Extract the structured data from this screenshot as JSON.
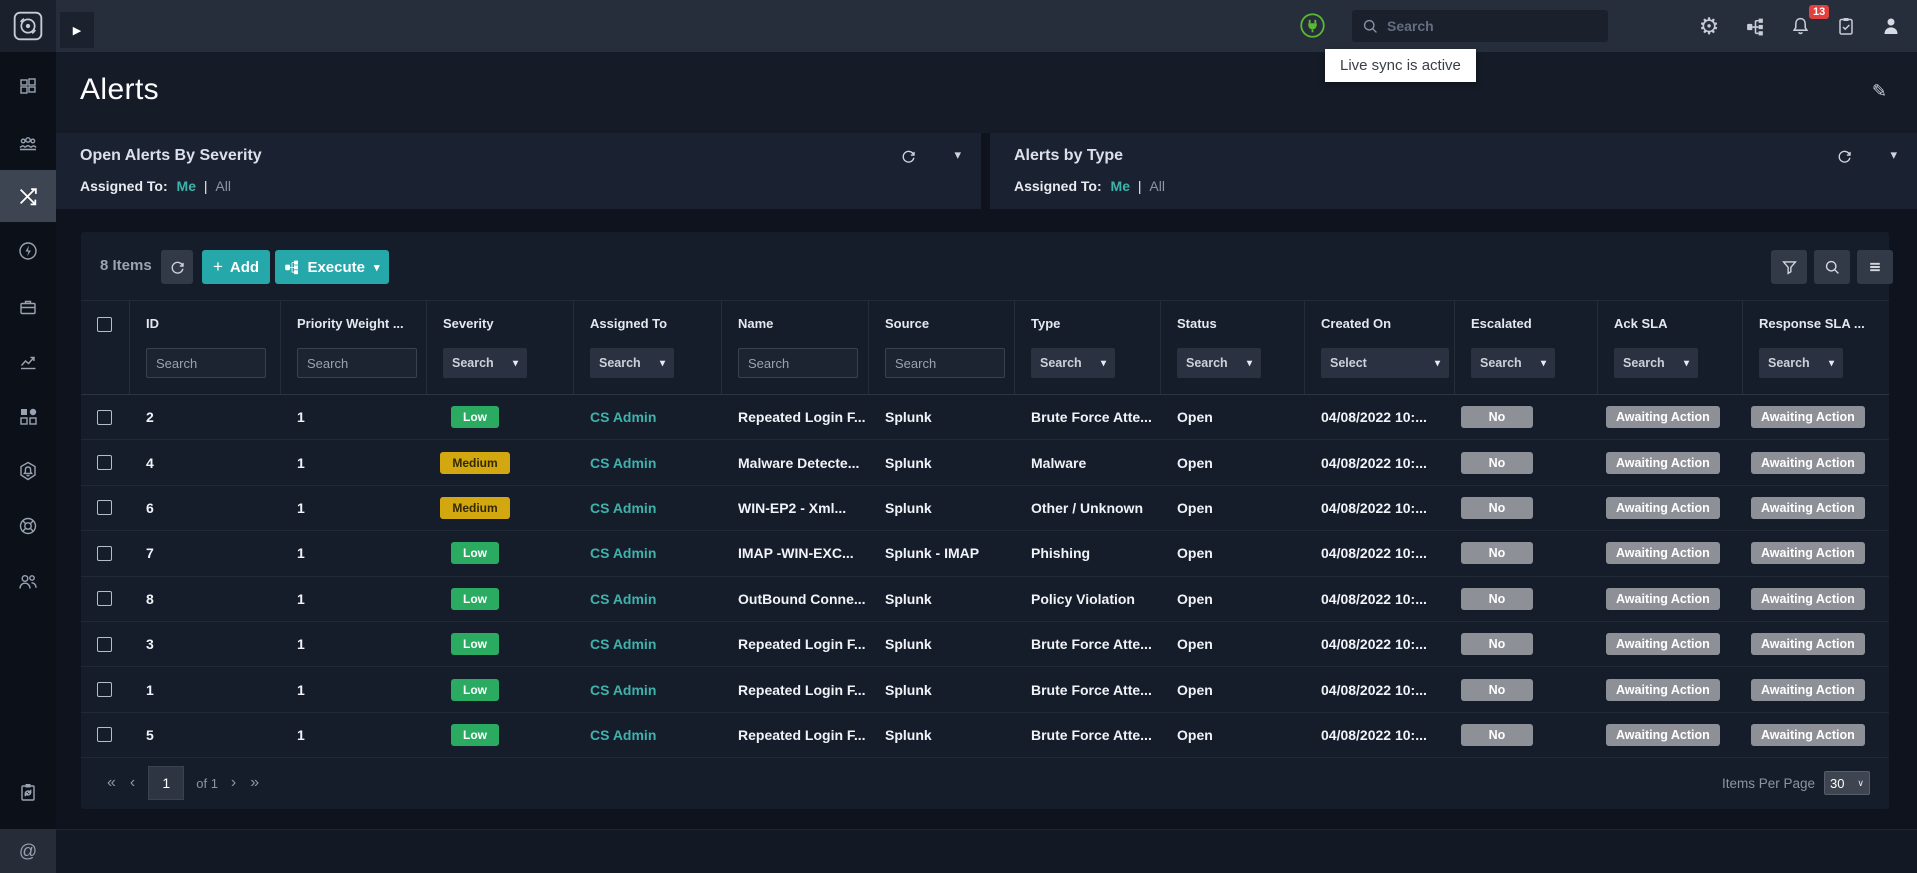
{
  "topbar": {
    "search_placeholder": "Search",
    "notification_count": "13",
    "tooltip": "Live sync is active",
    "icons": [
      "settings-gear",
      "integrations",
      "notifications-bell",
      "tasks-clipboard",
      "user"
    ]
  },
  "sidebar": {
    "icons": [
      "logo-target",
      "dashboard-grid",
      "team",
      "shuffle",
      "bolt-circle",
      "briefcase",
      "line-chart",
      "apps",
      "shield-bell",
      "globe",
      "users",
      "clipboard-sync",
      "at-mention"
    ],
    "active_icon": "shuffle"
  },
  "page": {
    "title": "Alerts"
  },
  "panels": [
    {
      "title": "Open Alerts By Severity",
      "assigned_label": "Assigned To:",
      "me": "Me",
      "sep": "|",
      "all": "All"
    },
    {
      "title": "Alerts by Type",
      "assigned_label": "Assigned To:",
      "me": "Me",
      "sep": "|",
      "all": "All"
    }
  ],
  "toolbar": {
    "items_count": "8 Items",
    "add_label": "Add",
    "add_plus": "+",
    "execute_label": "Execute",
    "caret": "▾"
  },
  "table": {
    "columns": [
      {
        "label": "ID",
        "filter": "input",
        "placeholder": "Search"
      },
      {
        "label": "Priority Weight  ...",
        "filter": "input",
        "placeholder": "Search"
      },
      {
        "label": "Severity",
        "filter": "select",
        "placeholder": "Search"
      },
      {
        "label": "Assigned To",
        "filter": "select",
        "placeholder": "Search"
      },
      {
        "label": "Name",
        "filter": "input",
        "placeholder": "Search"
      },
      {
        "label": "Source",
        "filter": "input",
        "placeholder": "Search"
      },
      {
        "label": "Type",
        "filter": "select",
        "placeholder": "Search"
      },
      {
        "label": "Status",
        "filter": "select",
        "placeholder": "Search"
      },
      {
        "label": "Created On",
        "filter": "select-wide",
        "placeholder": "Select"
      },
      {
        "label": "Escalated",
        "filter": "select",
        "placeholder": "Search"
      },
      {
        "label": "Ack SLA",
        "filter": "select",
        "placeholder": "Search"
      },
      {
        "label": "Response SLA  ...",
        "filter": "select",
        "placeholder": "Search"
      }
    ],
    "rows": [
      {
        "id": "2",
        "priority_weight": "1",
        "severity": "Low",
        "severity_level": "low",
        "assigned_to": "CS Admin",
        "name": "Repeated Login F...",
        "source": "Splunk",
        "type": "Brute Force Atte...",
        "status": "Open",
        "created_on": "04/08/2022 10:...",
        "escalated": "No",
        "ack_sla": "Awaiting Action",
        "response_sla": "Awaiting Action"
      },
      {
        "id": "4",
        "priority_weight": "1",
        "severity": "Medium",
        "severity_level": "medium",
        "assigned_to": "CS Admin",
        "name": "Malware Detecte...",
        "source": "Splunk",
        "type": "Malware",
        "status": "Open",
        "created_on": "04/08/2022 10:...",
        "escalated": "No",
        "ack_sla": "Awaiting Action",
        "response_sla": "Awaiting Action"
      },
      {
        "id": "6",
        "priority_weight": "1",
        "severity": "Medium",
        "severity_level": "medium",
        "assigned_to": "CS Admin",
        "name": "WIN-EP2 - Xml...",
        "source": "Splunk",
        "type": "Other / Unknown",
        "status": "Open",
        "created_on": "04/08/2022 10:...",
        "escalated": "No",
        "ack_sla": "Awaiting Action",
        "response_sla": "Awaiting Action"
      },
      {
        "id": "7",
        "priority_weight": "1",
        "severity": "Low",
        "severity_level": "low",
        "assigned_to": "CS Admin",
        "name": "IMAP -WIN-EXC...",
        "source": "Splunk - IMAP",
        "type": "Phishing",
        "status": "Open",
        "created_on": "04/08/2022 10:...",
        "escalated": "No",
        "ack_sla": "Awaiting Action",
        "response_sla": "Awaiting Action"
      },
      {
        "id": "8",
        "priority_weight": "1",
        "severity": "Low",
        "severity_level": "low",
        "assigned_to": "CS Admin",
        "name": "OutBound Conne...",
        "source": "Splunk",
        "type": "Policy Violation",
        "status": "Open",
        "created_on": "04/08/2022 10:...",
        "escalated": "No",
        "ack_sla": "Awaiting Action",
        "response_sla": "Awaiting Action"
      },
      {
        "id": "3",
        "priority_weight": "1",
        "severity": "Low",
        "severity_level": "low",
        "assigned_to": "CS Admin",
        "name": "Repeated Login F...",
        "source": "Splunk",
        "type": "Brute Force Atte...",
        "status": "Open",
        "created_on": "04/08/2022 10:...",
        "escalated": "No",
        "ack_sla": "Awaiting Action",
        "response_sla": "Awaiting Action"
      },
      {
        "id": "1",
        "priority_weight": "1",
        "severity": "Low",
        "severity_level": "low",
        "assigned_to": "CS Admin",
        "name": "Repeated Login F...",
        "source": "Splunk",
        "type": "Brute Force Atte...",
        "status": "Open",
        "created_on": "04/08/2022 10:...",
        "escalated": "No",
        "ack_sla": "Awaiting Action",
        "response_sla": "Awaiting Action"
      },
      {
        "id": "5",
        "priority_weight": "1",
        "severity": "Low",
        "severity_level": "low",
        "assigned_to": "CS Admin",
        "name": "Repeated Login F...",
        "source": "Splunk",
        "type": "Brute Force Atte...",
        "status": "Open",
        "created_on": "04/08/2022 10:...",
        "escalated": "No",
        "ack_sla": "Awaiting Action",
        "response_sla": "Awaiting Action"
      }
    ],
    "pagination": {
      "first": "«",
      "prev": "‹",
      "page": "1",
      "of_label": "of 1",
      "next": "›",
      "last": "»",
      "items_per_page_label": "Items Per Page",
      "items_per_page_value": "30"
    }
  },
  "colors": {
    "accent_teal": "#26a7aa",
    "link_teal": "#3fb2ac",
    "severity_low": "#2bab62",
    "severity_medium": "#d2a70f",
    "badge_gray": "#8d9197",
    "live_sync_green": "#5cb832",
    "notification_red": "#e23f3f"
  }
}
